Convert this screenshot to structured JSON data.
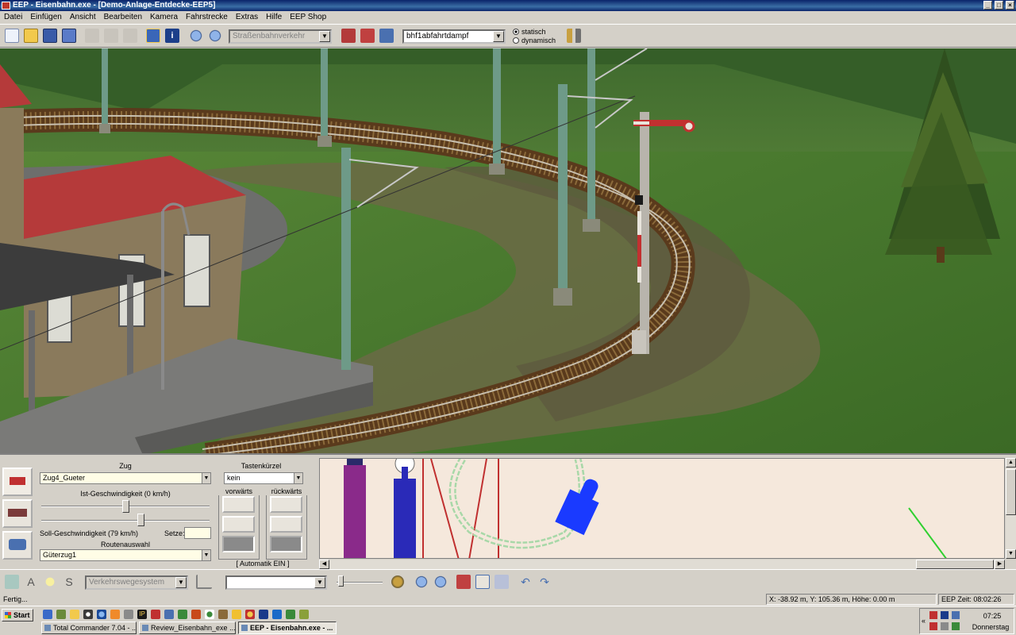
{
  "window": {
    "title": "EEP - Eisenbahn.exe - [Demo-Anlage-Entdecke-EEP5]"
  },
  "menu": [
    "Datei",
    "Einfügen",
    "Ansicht",
    "Bearbeiten",
    "Kamera",
    "Fahrstrecke",
    "Extras",
    "Hilfe",
    "EEP Shop"
  ],
  "toolbar": {
    "track_type": "Straßenbahnverkehr",
    "sound_select": "bhf1abfahrtdampf",
    "radio_static": "statisch",
    "radio_dynamic": "dynamisch",
    "selected_radio": "statisch"
  },
  "control_panel": {
    "train_label": "Zug",
    "train_value": "Zug4_Gueter",
    "shortcut_label": "Tastenkürzel",
    "shortcut_value": "kein",
    "actual_speed_label": "Ist-Geschwindigkeit (0 km/h)",
    "target_speed_label": "Soll-Geschwindigkeit (79 km/h)",
    "set_label": "Setze:",
    "set_value": "",
    "route_label": "Routenauswahl",
    "route_value": "Güterzug1",
    "forward_label": "vorwärts",
    "backward_label": "rückwärts",
    "auto_label": "[ Automatik EIN ]"
  },
  "bottom_toolbar": {
    "signal_system": "Verkehrswegesystem",
    "empty_select": ""
  },
  "status": {
    "left": "Fertig...",
    "coords": "X: -38.92 m, Y: 105.36 m, Höhe: 0.00 m",
    "time": "EEP Zeit: 08:02:26"
  },
  "taskbar": {
    "start": "Start",
    "tasks": [
      "Total Commander 7.04 - ...",
      "Review_Eisenbahn_exe ...",
      "EEP - Eisenbahn.exe - ..."
    ],
    "clock": "07:25",
    "day": "Donnerstag"
  },
  "colors": {
    "title_bar": "#0a246a",
    "grass": "#3f6b2a",
    "plan_background": "#f5e8dc",
    "field_background": "#fffde6"
  }
}
